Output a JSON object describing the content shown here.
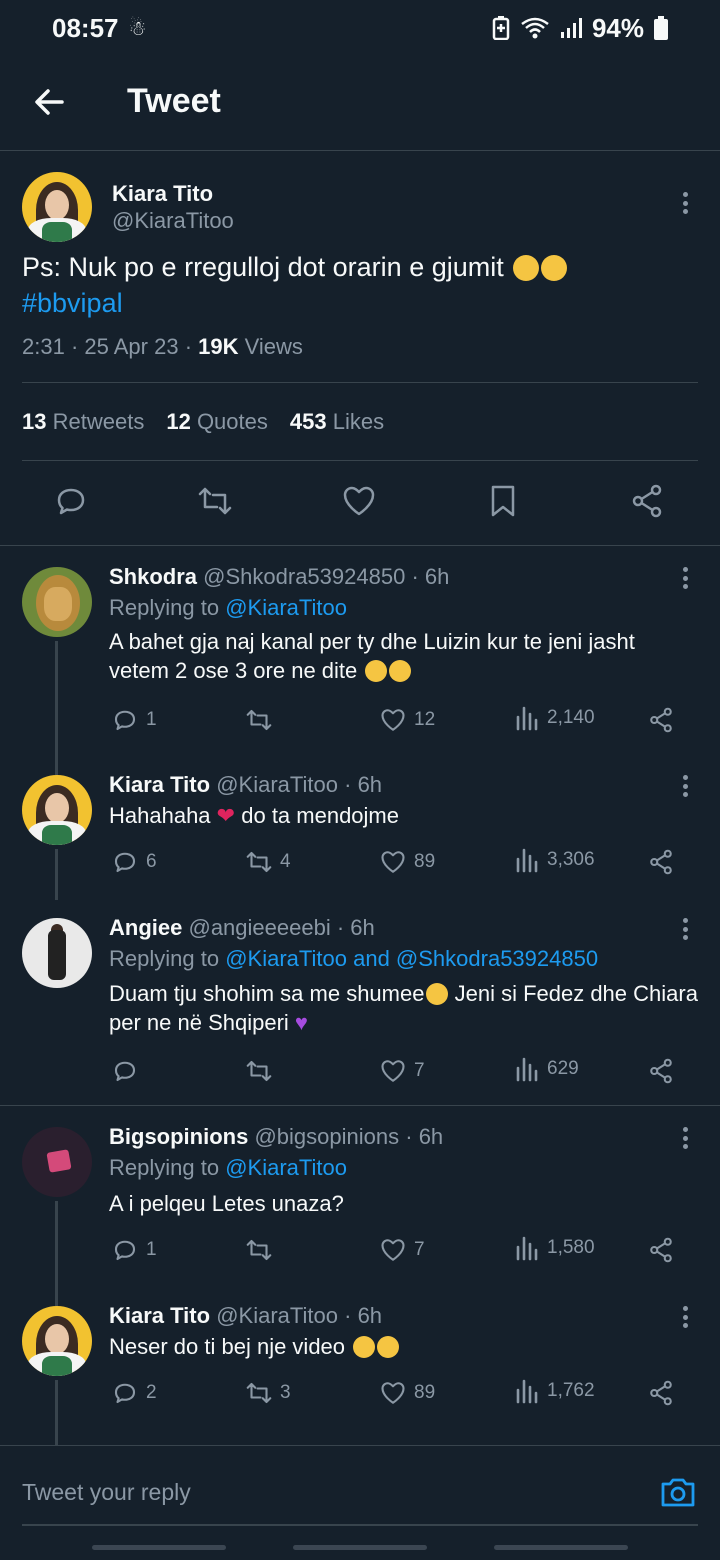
{
  "status_bar": {
    "time": "08:57",
    "battery": "94%"
  },
  "header": {
    "title": "Tweet"
  },
  "main_tweet": {
    "name": "Kiara Tito",
    "handle": "@KiaraTitoo",
    "text": "Ps: Nuk po e rregulloj dot orarin e gjumit",
    "hashtag": "#bbvipal",
    "time": "2:31",
    "date": "25 Apr 23",
    "views_count": "19K",
    "views_label": "Views",
    "retweets_count": "13",
    "retweets_label": "Retweets",
    "quotes_count": "12",
    "quotes_label": "Quotes",
    "likes_count": "453",
    "likes_label": "Likes"
  },
  "replies": [
    {
      "name": "Shkodra",
      "handle": "@Shkodra53924850",
      "time": "6h",
      "replying_label": "Replying to",
      "replying_to": "@KiaraTitoo",
      "text": "A bahet gja naj kanal per ty dhe Luizin kur te jeni jasht vetem 2 ose 3 ore ne dite",
      "replies": "1",
      "retweets": "",
      "likes": "12",
      "views": "2,140"
    },
    {
      "name": "Kiara Tito",
      "handle": "@KiaraTitoo",
      "time": "6h",
      "text_a": "Hahahaha",
      "text_b": "do ta mendojme",
      "replies": "6",
      "retweets": "4",
      "likes": "89",
      "views": "3,306"
    },
    {
      "name": "Angiee",
      "handle": "@angieeeeebi",
      "time": "6h",
      "replying_label": "Replying to",
      "replying_to": "@KiaraTitoo and @Shkodra53924850",
      "text_a": "Duam tju shohim sa me shumee",
      "text_b": "Jeni si Fedez dhe Chiara per ne në Shqiperi",
      "replies": "",
      "retweets": "",
      "likes": "7",
      "views": "629"
    },
    {
      "name": "Bigsopinions",
      "handle": "@bigsopinions",
      "time": "6h",
      "replying_label": "Replying to",
      "replying_to": "@KiaraTitoo",
      "text": "A i pelqeu Letes unaza?",
      "replies": "1",
      "retweets": "",
      "likes": "7",
      "views": "1,580"
    },
    {
      "name": "Kiara Tito",
      "handle": "@KiaraTitoo",
      "time": "6h",
      "text": "Neser do ti bej nje video",
      "replies": "2",
      "retweets": "3",
      "likes": "89",
      "views": "1,762"
    }
  ],
  "composer": {
    "placeholder": "Tweet your reply"
  },
  "icons": [
    "back-arrow-icon",
    "reply-icon",
    "retweet-icon",
    "like-icon",
    "bookmark-icon",
    "share-icon",
    "views-icon",
    "more-icon",
    "camera-icon"
  ],
  "colors": {
    "background": "#15202b",
    "accent": "#1d9bf0",
    "muted": "#8b98a5",
    "divider": "#38444d"
  }
}
